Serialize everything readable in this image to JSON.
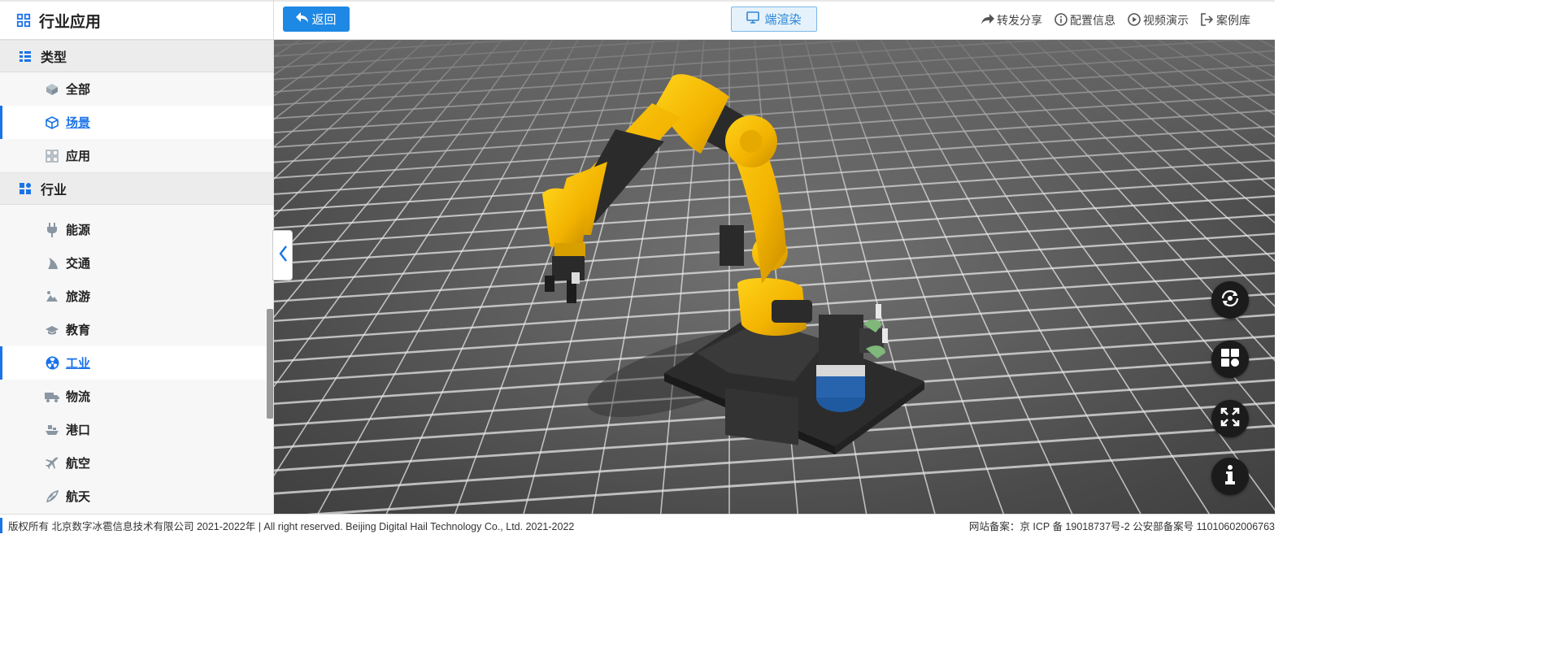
{
  "sidebar": {
    "title": "行业应用",
    "sections": [
      {
        "label": "类型",
        "items": [
          {
            "label": "全部",
            "icon": "cube-icon"
          },
          {
            "label": "场景",
            "icon": "box-outline-icon",
            "active": true
          },
          {
            "label": "应用",
            "icon": "grid-icon"
          }
        ]
      },
      {
        "label": "行业",
        "items": [
          {
            "label": "能源",
            "icon": "plug-icon"
          },
          {
            "label": "交通",
            "icon": "road-icon"
          },
          {
            "label": "旅游",
            "icon": "travel-icon"
          },
          {
            "label": "教育",
            "icon": "graduation-cap-icon"
          },
          {
            "label": "工业",
            "icon": "radiation-icon",
            "active": true
          },
          {
            "label": "物流",
            "icon": "truck-icon"
          },
          {
            "label": "港口",
            "icon": "ship-icon"
          },
          {
            "label": "航空",
            "icon": "plane-icon"
          },
          {
            "label": "航天",
            "icon": "rocket-icon"
          }
        ]
      }
    ]
  },
  "topbar": {
    "back_label": "返回",
    "render_label": "端渲染",
    "links": {
      "share": "转发分享",
      "config": "配置信息",
      "video": "视频演示",
      "cases": "案例库"
    }
  },
  "viewport": {
    "scene": "yellow industrial robot arm on a grid floor",
    "controls": [
      "rotate-icon",
      "layout-icon",
      "fullscreen-icon",
      "info-icon"
    ]
  },
  "footer": {
    "left": "版权所有 北京数字冰雹信息技术有限公司 2021-2022年 | All right reserved. Beijing Digital Hail Technology Co., Ltd. 2021-2022",
    "right": "网站备案：京 ICP 备 19018737号-2 公安部备案号 11010602006763"
  },
  "colors": {
    "accent": "#1a73e8",
    "robot_yellow": "#f5b800",
    "floor": "#5e5e5e"
  }
}
